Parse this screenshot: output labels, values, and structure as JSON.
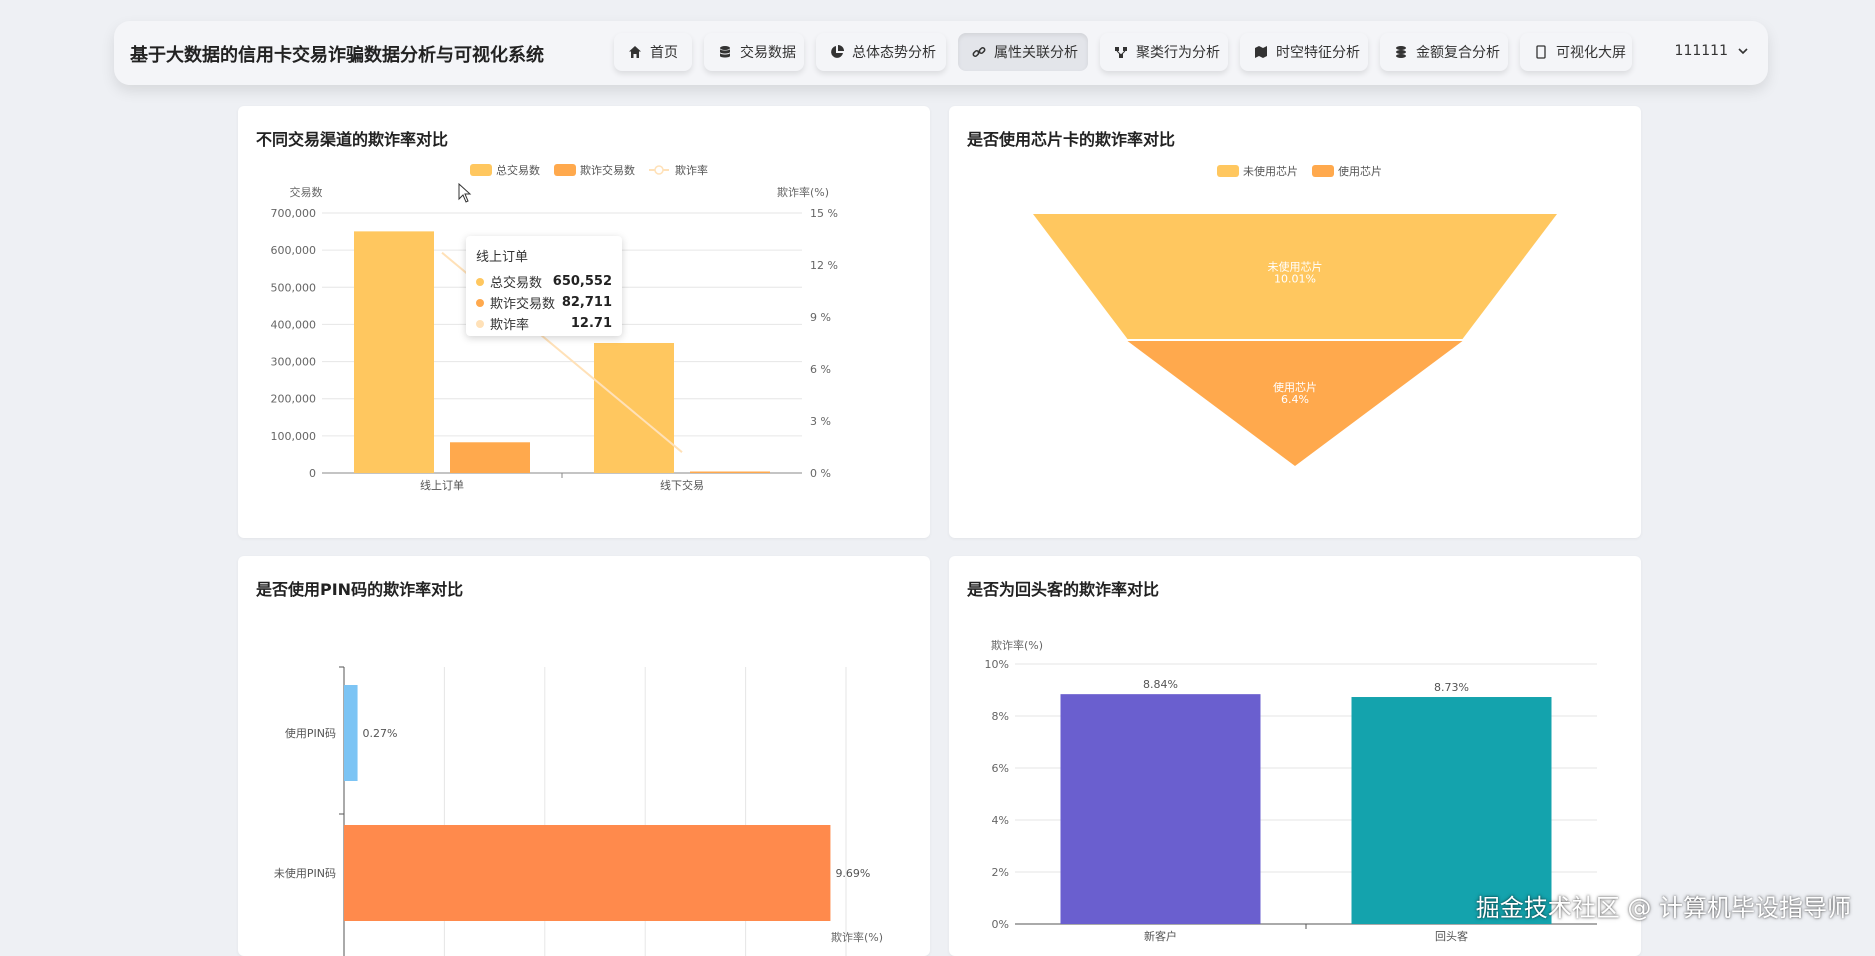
{
  "app": {
    "title": "基于大数据的信用卡交易诈骗数据分析与可视化系统",
    "user": "111111",
    "nav": [
      {
        "label": "首页",
        "icon": "home-icon"
      },
      {
        "label": "交易数据",
        "icon": "database-icon"
      },
      {
        "label": "总体态势分析",
        "icon": "pie-chart-icon"
      },
      {
        "label": "属性关联分析",
        "icon": "link-icon",
        "active": true
      },
      {
        "label": "聚类行为分析",
        "icon": "cluster-icon"
      },
      {
        "label": "时空特征分析",
        "icon": "map-icon"
      },
      {
        "label": "金额复合分析",
        "icon": "coins-icon"
      },
      {
        "label": "可视化大屏",
        "icon": "screen-icon"
      }
    ]
  },
  "cards": {
    "channel": {
      "title": "不同交易渠道的欺诈率对比"
    },
    "chip": {
      "title": "是否使用芯片卡的欺诈率对比"
    },
    "pin": {
      "title": "是否使用PIN码的欺诈率对比"
    },
    "repeat": {
      "title": "是否为回头客的欺诈率对比"
    }
  },
  "tooltip": {
    "title": "线上订单",
    "rows": [
      {
        "name": "总交易数",
        "value": "650,552",
        "color": "#ffc75f"
      },
      {
        "name": "欺诈交易数",
        "value": "82,711",
        "color": "#ffa94d"
      },
      {
        "name": "欺诈率",
        "value": "12.71",
        "color": "#ffe1b8"
      }
    ]
  },
  "watermark": "掘金技术社区 @ 计算机毕设指导师",
  "chart_data": [
    {
      "id": "channel",
      "type": "bar",
      "categories": [
        "线上订单",
        "线下交易"
      ],
      "series": [
        {
          "name": "总交易数",
          "values": [
            650552,
            350000
          ],
          "axis": "left",
          "color": "#ffc75f"
        },
        {
          "name": "欺诈交易数",
          "values": [
            82711,
            4000
          ],
          "axis": "left",
          "color": "#ffa94d"
        },
        {
          "name": "欺诈率",
          "values": [
            12.71,
            1.2
          ],
          "axis": "right",
          "type": "line",
          "color": "#ffe1b8"
        }
      ],
      "ylabel": "交易数",
      "y2label": "欺诈率(%)",
      "ylim": [
        0,
        700000
      ],
      "yticks": [
        "700,000",
        "600,000",
        "500,000",
        "400,000",
        "300,000",
        "200,000",
        "100,000",
        "0"
      ],
      "y2lim": [
        0,
        15
      ],
      "y2ticks": [
        "15 %",
        "12 %",
        "9 %",
        "6 %",
        "3 %",
        "0 %"
      ],
      "legend": "top-center"
    },
    {
      "id": "chip",
      "type": "funnel",
      "series": [
        {
          "name": "未使用芯片",
          "value": 10.01,
          "label": "未使用芯片\n10.01%",
          "color": "#ffc75f"
        },
        {
          "name": "使用芯片",
          "value": 6.4,
          "label": "使用芯片\n6.4%",
          "color": "#ffa94d"
        }
      ],
      "legend": "top-center"
    },
    {
      "id": "pin",
      "type": "bar",
      "orientation": "horizontal",
      "categories": [
        "使用PIN码",
        "未使用PIN码"
      ],
      "values": [
        0.27,
        9.69
      ],
      "labels": [
        "0.27%",
        "9.69%"
      ],
      "colors": [
        "#7cc4f4",
        "#ff8a4c"
      ],
      "xlabel": "欺诈率(%)",
      "xlim": [
        0,
        10
      ]
    },
    {
      "id": "repeat",
      "type": "bar",
      "categories": [
        "新客户",
        "回头客"
      ],
      "values": [
        8.84,
        8.73
      ],
      "labels": [
        "8.84%",
        "8.73%"
      ],
      "colors": [
        "#6a5fcf",
        "#14a3ad"
      ],
      "ylabel": "欺诈率(%)",
      "ylim": [
        0,
        10
      ],
      "yticks": [
        "10%",
        "8%",
        "6%",
        "4%",
        "2%",
        "0%"
      ]
    }
  ]
}
